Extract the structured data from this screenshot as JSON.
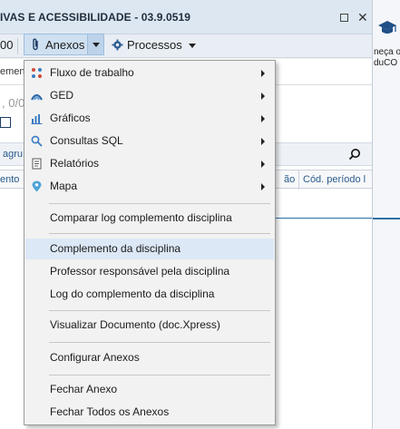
{
  "window": {
    "title": "IVAS E ACESSIBILIDADE - 03.9.0519"
  },
  "toolbar": {
    "left_fragment": "00",
    "anexos_label": "Anexos",
    "processos_label": "Processos"
  },
  "right_pane": {
    "line1": "neça o",
    "line2": "duCO"
  },
  "background": {
    "frag_1": "ement",
    "frag_2": ", 0/0",
    "frag_3": "agru",
    "col_1": "ento",
    "col_2": "ão",
    "col_3": "Cód. período l"
  },
  "menu": {
    "submenus": [
      {
        "label": "Fluxo de trabalho",
        "icon": "workflow-icon"
      },
      {
        "label": "GED",
        "icon": "ged-icon"
      },
      {
        "label": "Gráficos",
        "icon": "chart-icon"
      },
      {
        "label": "Consultas SQL",
        "icon": "search-icon"
      },
      {
        "label": "Relatórios",
        "icon": "report-icon"
      },
      {
        "label": "Mapa",
        "icon": "map-pin-icon"
      }
    ],
    "compare": "Comparar log complemento disciplina",
    "complemento": "Complemento da disciplina",
    "professor": "Professor responsável pela disciplina",
    "log": "Log do complemento da disciplina",
    "visualizar": "Visualizar Documento (doc.Xpress)",
    "configurar": "Configurar Anexos",
    "fechar": "Fechar Anexo",
    "fechar_todos": "Fechar Todos os Anexos"
  },
  "colors": {
    "highlight": "#dce8f6",
    "accent": "#2e6fa7",
    "icon_blue": "#3a7cc4"
  }
}
